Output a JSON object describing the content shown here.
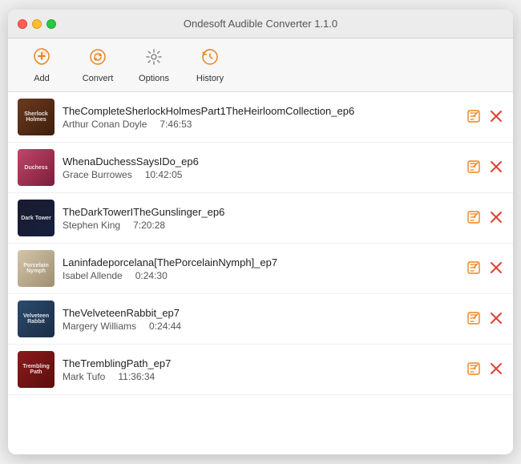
{
  "window": {
    "title": "Ondesoft Audible Converter 1.1.0"
  },
  "toolbar": {
    "add_label": "Add",
    "convert_label": "Convert",
    "options_label": "Options",
    "history_label": "History"
  },
  "books": [
    {
      "id": 1,
      "title": "TheCompleteSherlockHolmesPart1TheHeirloomCollection_ep6",
      "author": "Arthur Conan Doyle",
      "duration": "7:46:53",
      "cover_class": "cover-1",
      "cover_text": "Sherlock Holmes"
    },
    {
      "id": 2,
      "title": "WhenaDuchessSaysIDo_ep6",
      "author": "Grace Burrowes",
      "duration": "10:42:05",
      "cover_class": "cover-2",
      "cover_text": "Duchess"
    },
    {
      "id": 3,
      "title": "TheDarkTowerITheGunslinger_ep6",
      "author": "Stephen King",
      "duration": "7:20:28",
      "cover_class": "cover-3",
      "cover_text": "Dark Tower"
    },
    {
      "id": 4,
      "title": "Laninfadeporcelana[ThePorcelainNymph]_ep7",
      "author": "Isabel Allende",
      "duration": "0:24:30",
      "cover_class": "cover-4",
      "cover_text": "Porcelain Nymph"
    },
    {
      "id": 5,
      "title": "TheVelveteenRabbit_ep7",
      "author": "Margery Williams",
      "duration": "0:24:44",
      "cover_class": "cover-5",
      "cover_text": "Velveteen Rabbit"
    },
    {
      "id": 6,
      "title": "TheTremblingPath_ep7",
      "author": "Mark Tufo",
      "duration": "11:36:34",
      "cover_class": "cover-6",
      "cover_text": "Trembling Path"
    }
  ]
}
